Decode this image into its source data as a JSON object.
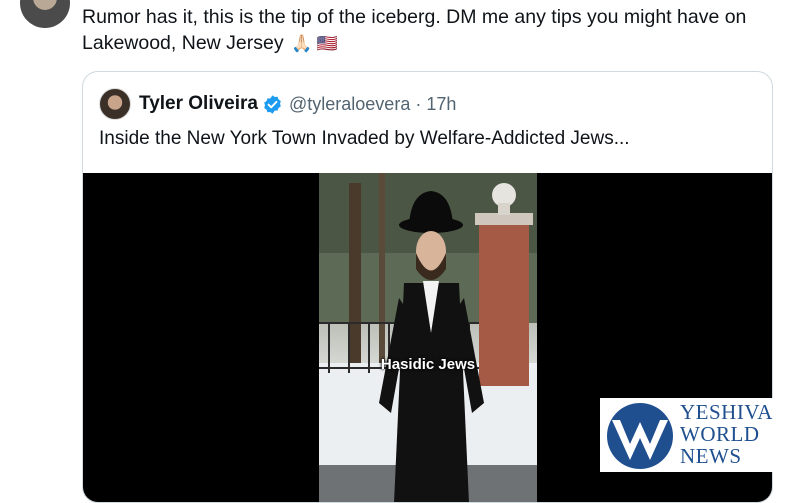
{
  "post": {
    "text": "Rumor has it, this is the tip of the iceberg. DM me any tips you might have on Lakewood, New Jersey",
    "emojis": "🙏🏻 🇺🇸"
  },
  "quoted_post": {
    "name": "Tyler Oliveira",
    "handle": "@tyleraloevera",
    "separator": "·",
    "time": "17h",
    "text": "Inside the New York Town Invaded by Welfare-Addicted Jews...",
    "video_caption": "Hasidic Jews"
  },
  "watermark": {
    "line1": "YESHIVA",
    "line2": "WORLD",
    "line3": "NEWS"
  },
  "colors": {
    "verified": "#1d9bf0",
    "muted_text": "#536471",
    "border": "#cfd9de",
    "watermark": "#1f4f8f"
  }
}
